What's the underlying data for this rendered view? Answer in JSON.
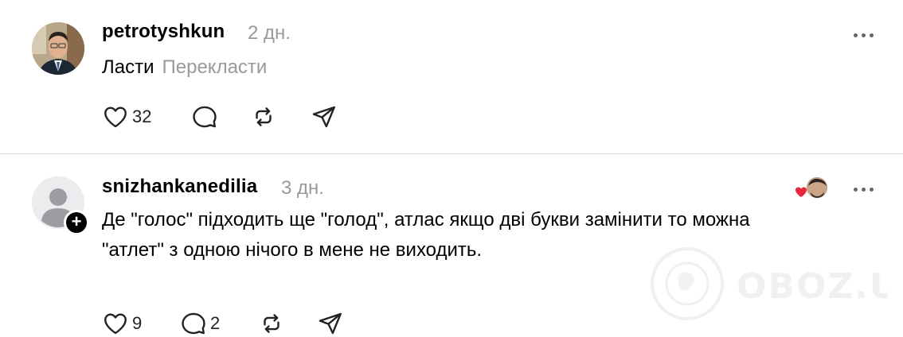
{
  "posts": [
    {
      "username": "petrotyshkun",
      "time": "2 дн.",
      "text": "Ласти",
      "translate_label": "Перекласти",
      "likes": "32"
    },
    {
      "username": "snizhankanedilia",
      "time": "3 дн.",
      "text_line1": "Де \"голос\" підходить ще \"голод\", атлас якщо дві букви замінити то можна",
      "text_line2": "\"атлет\" з одною нічого в мене не виходить.",
      "likes": "9",
      "replies": "2"
    }
  ],
  "watermark": {
    "text": "OBOZ.UA"
  },
  "icons": {
    "like": "heart-icon",
    "reply": "comment-icon",
    "repost": "repost-icon",
    "share": "send-icon",
    "more": "more-icon"
  },
  "colors": {
    "muted": "#999999",
    "liked_heart": "#e8283b",
    "divider": "#dcdcdc"
  }
}
